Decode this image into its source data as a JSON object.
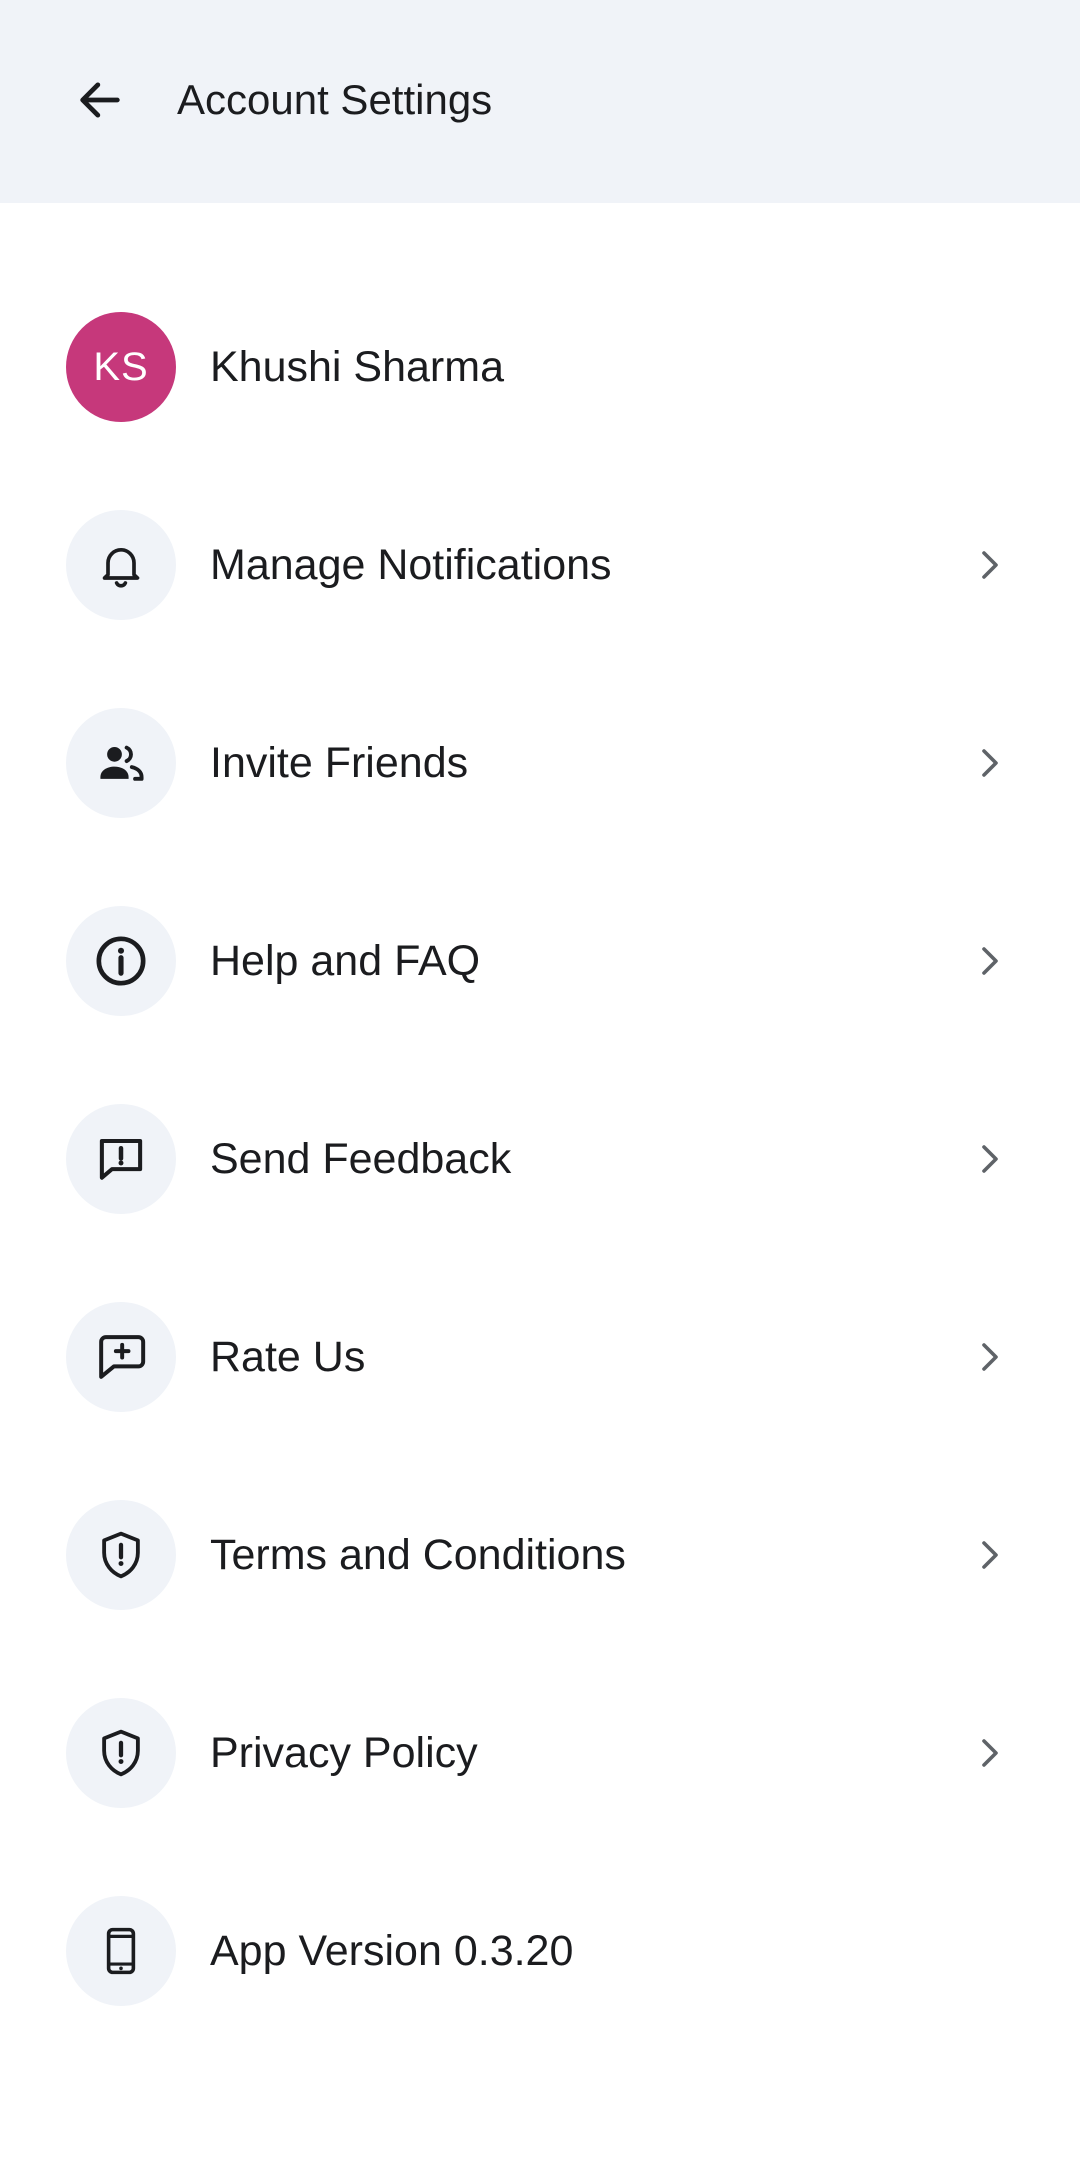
{
  "header": {
    "title": "Account Settings",
    "back_icon": "arrow-left-icon"
  },
  "profile": {
    "initials": "KS",
    "name": "Khushi Sharma",
    "avatar_color": "#c6387b"
  },
  "menu": [
    {
      "label": "Manage Notifications",
      "icon": "bell-icon"
    },
    {
      "label": "Invite Friends",
      "icon": "people-icon"
    },
    {
      "label": "Help and FAQ",
      "icon": "info-icon"
    },
    {
      "label": "Send Feedback",
      "icon": "feedback-icon"
    },
    {
      "label": "Rate Us",
      "icon": "rate-chat-icon"
    },
    {
      "label": "Terms and Conditions",
      "icon": "shield-alert-icon"
    },
    {
      "label": "Privacy Policy",
      "icon": "shield-alert-icon"
    }
  ],
  "app_version": {
    "label": "App Version 0.3.20",
    "icon": "phone-icon"
  },
  "colors": {
    "header_bg": "#f0f3f8",
    "icon_bg": "#f0f3f8",
    "text": "#1b1c1f",
    "chevron": "#5f6368"
  }
}
